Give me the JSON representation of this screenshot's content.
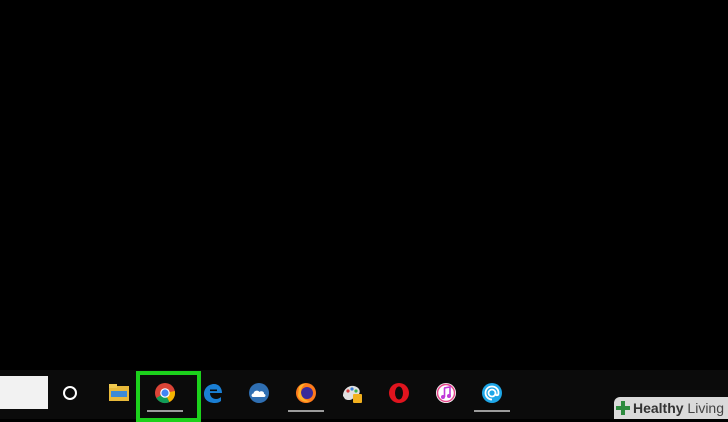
{
  "taskbar": {
    "search_box": "",
    "icons": [
      {
        "name": "cortana-icon"
      },
      {
        "name": "file-explorer-icon"
      },
      {
        "name": "chrome-icon",
        "highlighted": true,
        "highlight_color": "#1cd11c"
      },
      {
        "name": "edge-icon"
      },
      {
        "name": "onedrive-icon"
      },
      {
        "name": "firefox-icon"
      },
      {
        "name": "paint-icon"
      },
      {
        "name": "opera-icon"
      },
      {
        "name": "itunes-icon"
      },
      {
        "name": "mail-icon"
      }
    ]
  },
  "watermark": {
    "brand_bold": "Healthy",
    "brand_rest": " Living",
    "accent_color": "#2e8b3f"
  }
}
